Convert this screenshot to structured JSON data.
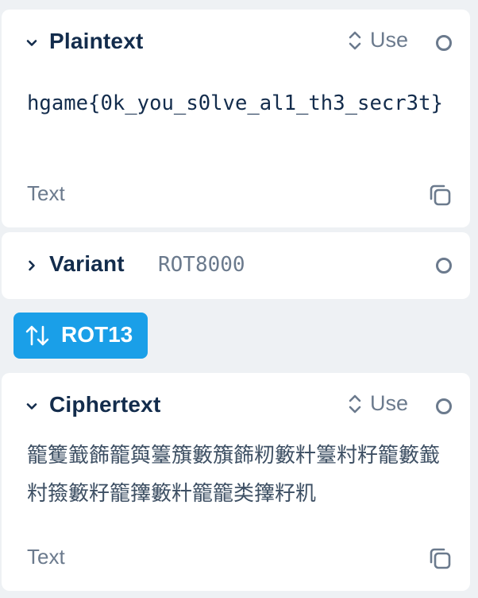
{
  "plaintext": {
    "title": "Plaintext",
    "use_label": "Use",
    "value": "hgame{0k_you_s0lve_al1_th3_secr3t}",
    "format_label": "Text",
    "icons": {
      "expand": "chevron-down-icon",
      "use": "sort-arrows-icon",
      "copy": "copy-icon"
    }
  },
  "variant": {
    "title": "Variant",
    "value": "ROT8000",
    "icons": {
      "expand": "chevron-right-icon"
    }
  },
  "action": {
    "label": "ROT13",
    "icon": "swap-arrows-icon"
  },
  "ciphertext": {
    "title": "Ciphertext",
    "use_label": "Use",
    "value": "籠籆籖籂籠籅籉籏籔籏籂籾籔籵籉籿籽籠籔籖籿籡籔籽籠籜籔籵籠籠类籜籽籶",
    "format_label": "Text",
    "icons": {
      "expand": "chevron-down-icon",
      "use": "sort-arrows-icon",
      "copy": "copy-icon"
    }
  },
  "colors": {
    "background": "#eef1f4",
    "card": "#ffffff",
    "title": "#132c4c",
    "muted": "#6b7a8d",
    "accent": "#1a9fe8"
  }
}
